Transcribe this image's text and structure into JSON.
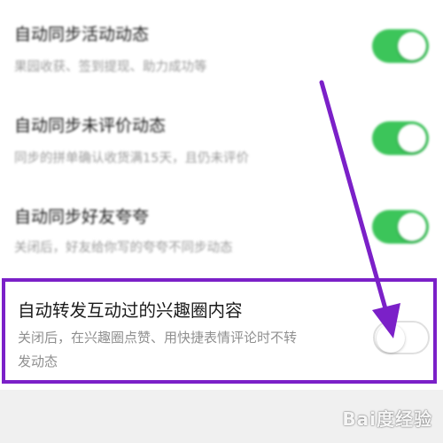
{
  "settings": [
    {
      "title": "自动同步活动动态",
      "desc": "果园收获、签到提现、助力成功等",
      "enabled": true
    },
    {
      "title": "自动同步未评价动态",
      "desc": "同步的拼单确认收货满15天，且仍未评价",
      "enabled": true
    },
    {
      "title": "自动同步好友夸夸",
      "desc": "关闭后，好友给你写的夸夸不同步动态",
      "enabled": true
    }
  ],
  "highlighted_setting": {
    "title": "自动转发互动过的兴趣圈内容",
    "desc_line1": "关闭后，在兴趣圈点赞、用快捷表情评论时不转",
    "desc_line2": "发动态",
    "enabled": false
  },
  "watermark": "Bai度经验",
  "colors": {
    "toggle_on": "#3cc55a",
    "highlight_border": "#7b20c8",
    "arrow": "#7b20c8"
  }
}
